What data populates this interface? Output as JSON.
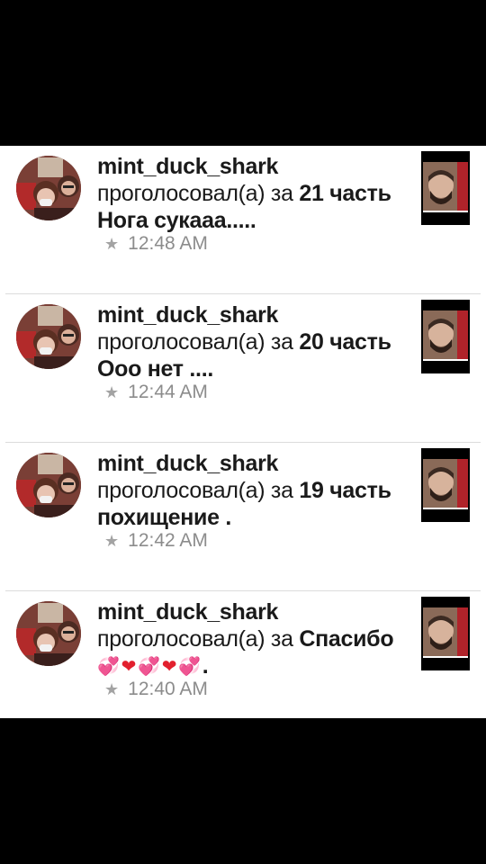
{
  "feed": {
    "items": [
      {
        "username": "mint_duck_shark",
        "action": "проголосовал(а) за",
        "part": "21 часть",
        "title": "Нога сукааа.....",
        "time": "12:48 AM"
      },
      {
        "username": "mint_duck_shark",
        "action": "проголосовал(а) за",
        "part": "20 часть",
        "title": "Ооо нет ....",
        "time": "12:44 AM"
      },
      {
        "username": "mint_duck_shark",
        "action": "проголосовал(а) за",
        "part": "19 часть",
        "title": "похищение .",
        "time": "12:42 AM"
      },
      {
        "username": "mint_duck_shark",
        "action": "проголосовал(а) за",
        "part": "Спасибо",
        "title_suffix": ".",
        "time": "12:40 AM"
      }
    ]
  },
  "icons": {
    "star": "star-icon",
    "heart_sparkle": "sparkling-heart-icon",
    "heart_red": "red-heart-icon"
  },
  "colors": {
    "text": "#1a1a1a",
    "meta": "#8c8c8c",
    "divider": "#dcdcdc",
    "heart_pink": "#ea3d92",
    "heart_red": "#e2202e"
  }
}
